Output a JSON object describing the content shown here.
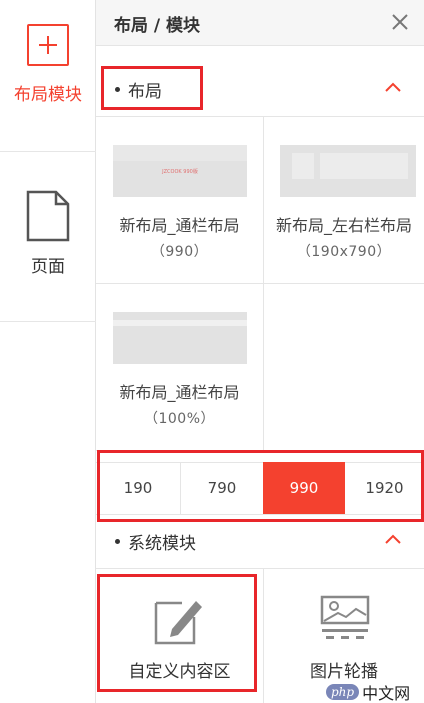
{
  "rail": {
    "items": [
      {
        "label": "布局模块",
        "icon": "plus-square-icon",
        "active": true
      },
      {
        "label": "页面",
        "icon": "document-icon",
        "active": false
      }
    ],
    "accent": "#f4412f"
  },
  "panel": {
    "title": "布局 / 模块",
    "close_icon": "close-icon",
    "sections": {
      "layout": {
        "label": "布局",
        "toggle_icon": "chevron-up-icon",
        "cards": [
          {
            "title": "新布局_通栏布局",
            "subtitle": "（990）",
            "thumb_text": "JZCOOK 990版"
          },
          {
            "title": "新布局_左右栏布局",
            "subtitle": "（190x790）"
          },
          {
            "title": "新布局_通栏布局",
            "subtitle": "（100%）"
          }
        ],
        "widths": [
          "190",
          "790",
          "990",
          "1920"
        ],
        "selected_width": "990"
      },
      "system": {
        "label": "系统模块",
        "toggle_icon": "chevron-up-icon",
        "modules": [
          {
            "label": "自定义内容区",
            "icon": "edit-icon"
          },
          {
            "label": "图片轮播",
            "icon": "image-carousel-icon"
          }
        ]
      }
    }
  },
  "watermark": {
    "badge": "php",
    "text": "中文网"
  }
}
